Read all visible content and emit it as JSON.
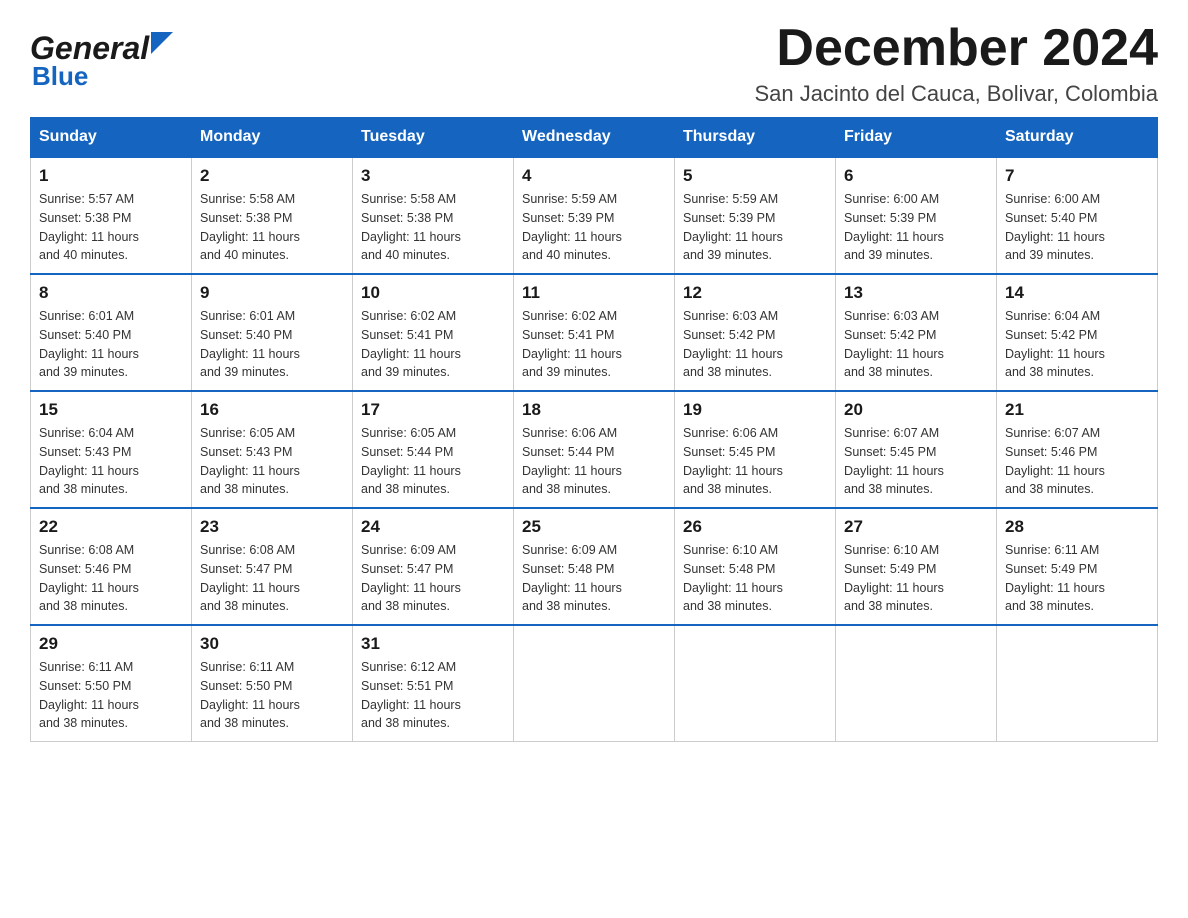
{
  "logo": {
    "general": "General",
    "blue": "Blue",
    "alt": "GeneralBlue Logo"
  },
  "header": {
    "month_year": "December 2024",
    "location": "San Jacinto del Cauca, Bolivar, Colombia"
  },
  "days_of_week": [
    "Sunday",
    "Monday",
    "Tuesday",
    "Wednesday",
    "Thursday",
    "Friday",
    "Saturday"
  ],
  "weeks": [
    [
      {
        "day": "1",
        "sunrise": "5:57 AM",
        "sunset": "5:38 PM",
        "daylight": "11 hours and 40 minutes."
      },
      {
        "day": "2",
        "sunrise": "5:58 AM",
        "sunset": "5:38 PM",
        "daylight": "11 hours and 40 minutes."
      },
      {
        "day": "3",
        "sunrise": "5:58 AM",
        "sunset": "5:38 PM",
        "daylight": "11 hours and 40 minutes."
      },
      {
        "day": "4",
        "sunrise": "5:59 AM",
        "sunset": "5:39 PM",
        "daylight": "11 hours and 40 minutes."
      },
      {
        "day": "5",
        "sunrise": "5:59 AM",
        "sunset": "5:39 PM",
        "daylight": "11 hours and 39 minutes."
      },
      {
        "day": "6",
        "sunrise": "6:00 AM",
        "sunset": "5:39 PM",
        "daylight": "11 hours and 39 minutes."
      },
      {
        "day": "7",
        "sunrise": "6:00 AM",
        "sunset": "5:40 PM",
        "daylight": "11 hours and 39 minutes."
      }
    ],
    [
      {
        "day": "8",
        "sunrise": "6:01 AM",
        "sunset": "5:40 PM",
        "daylight": "11 hours and 39 minutes."
      },
      {
        "day": "9",
        "sunrise": "6:01 AM",
        "sunset": "5:40 PM",
        "daylight": "11 hours and 39 minutes."
      },
      {
        "day": "10",
        "sunrise": "6:02 AM",
        "sunset": "5:41 PM",
        "daylight": "11 hours and 39 minutes."
      },
      {
        "day": "11",
        "sunrise": "6:02 AM",
        "sunset": "5:41 PM",
        "daylight": "11 hours and 39 minutes."
      },
      {
        "day": "12",
        "sunrise": "6:03 AM",
        "sunset": "5:42 PM",
        "daylight": "11 hours and 38 minutes."
      },
      {
        "day": "13",
        "sunrise": "6:03 AM",
        "sunset": "5:42 PM",
        "daylight": "11 hours and 38 minutes."
      },
      {
        "day": "14",
        "sunrise": "6:04 AM",
        "sunset": "5:42 PM",
        "daylight": "11 hours and 38 minutes."
      }
    ],
    [
      {
        "day": "15",
        "sunrise": "6:04 AM",
        "sunset": "5:43 PM",
        "daylight": "11 hours and 38 minutes."
      },
      {
        "day": "16",
        "sunrise": "6:05 AM",
        "sunset": "5:43 PM",
        "daylight": "11 hours and 38 minutes."
      },
      {
        "day": "17",
        "sunrise": "6:05 AM",
        "sunset": "5:44 PM",
        "daylight": "11 hours and 38 minutes."
      },
      {
        "day": "18",
        "sunrise": "6:06 AM",
        "sunset": "5:44 PM",
        "daylight": "11 hours and 38 minutes."
      },
      {
        "day": "19",
        "sunrise": "6:06 AM",
        "sunset": "5:45 PM",
        "daylight": "11 hours and 38 minutes."
      },
      {
        "day": "20",
        "sunrise": "6:07 AM",
        "sunset": "5:45 PM",
        "daylight": "11 hours and 38 minutes."
      },
      {
        "day": "21",
        "sunrise": "6:07 AM",
        "sunset": "5:46 PM",
        "daylight": "11 hours and 38 minutes."
      }
    ],
    [
      {
        "day": "22",
        "sunrise": "6:08 AM",
        "sunset": "5:46 PM",
        "daylight": "11 hours and 38 minutes."
      },
      {
        "day": "23",
        "sunrise": "6:08 AM",
        "sunset": "5:47 PM",
        "daylight": "11 hours and 38 minutes."
      },
      {
        "day": "24",
        "sunrise": "6:09 AM",
        "sunset": "5:47 PM",
        "daylight": "11 hours and 38 minutes."
      },
      {
        "day": "25",
        "sunrise": "6:09 AM",
        "sunset": "5:48 PM",
        "daylight": "11 hours and 38 minutes."
      },
      {
        "day": "26",
        "sunrise": "6:10 AM",
        "sunset": "5:48 PM",
        "daylight": "11 hours and 38 minutes."
      },
      {
        "day": "27",
        "sunrise": "6:10 AM",
        "sunset": "5:49 PM",
        "daylight": "11 hours and 38 minutes."
      },
      {
        "day": "28",
        "sunrise": "6:11 AM",
        "sunset": "5:49 PM",
        "daylight": "11 hours and 38 minutes."
      }
    ],
    [
      {
        "day": "29",
        "sunrise": "6:11 AM",
        "sunset": "5:50 PM",
        "daylight": "11 hours and 38 minutes."
      },
      {
        "day": "30",
        "sunrise": "6:11 AM",
        "sunset": "5:50 PM",
        "daylight": "11 hours and 38 minutes."
      },
      {
        "day": "31",
        "sunrise": "6:12 AM",
        "sunset": "5:51 PM",
        "daylight": "11 hours and 38 minutes."
      },
      null,
      null,
      null,
      null
    ]
  ],
  "labels": {
    "sunrise": "Sunrise:",
    "sunset": "Sunset:",
    "daylight": "Daylight:"
  },
  "colors": {
    "header_bg": "#1565c0",
    "header_text": "#ffffff",
    "border": "#1565c0",
    "cell_border": "#cccccc"
  }
}
